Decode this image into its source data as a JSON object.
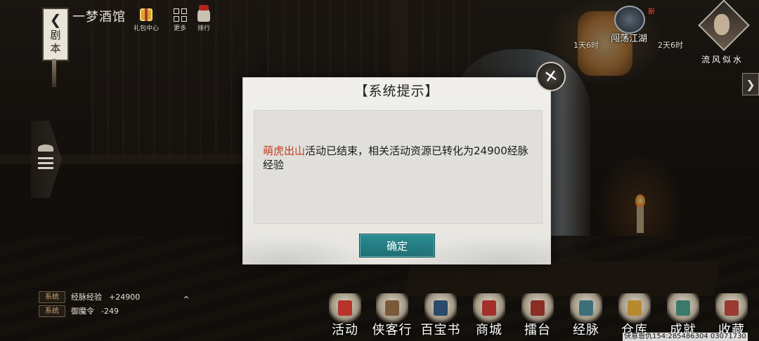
{
  "header": {
    "back_label": "剧本",
    "location": "一梦酒馆",
    "top_icons": [
      {
        "label": "礼包中心",
        "icon": "gift-icon"
      },
      {
        "label": "更多",
        "icon": "more-grid-icon"
      },
      {
        "label": "排行",
        "icon": "ranking-icon"
      }
    ]
  },
  "event": {
    "label": "闯荡江湖",
    "new_tag": "新",
    "timer_left": "1天6时",
    "timer_right": "2天6时"
  },
  "player": {
    "name": "流风似水"
  },
  "dialog": {
    "title": "【系统提示】",
    "highlight": "萌虎出山",
    "message": "活动已结束，相关活动资源已转化为24900经脉经验",
    "confirm": "确定"
  },
  "log": [
    {
      "tag": "系统",
      "text": "经脉经验",
      "value": "+24900"
    },
    {
      "tag": "系统",
      "text": "御魔令",
      "value": "-249"
    }
  ],
  "nav": [
    {
      "label": "活动",
      "icon": "drum-icon",
      "color": "#b8342a"
    },
    {
      "label": "侠客行",
      "icon": "scroll-icon",
      "color": "#7a5a3a"
    },
    {
      "label": "百宝书",
      "icon": "book-icon",
      "color": "#2c4a6b"
    },
    {
      "label": "商城",
      "icon": "shop-icon",
      "color": "#a3302a"
    },
    {
      "label": "擂台",
      "icon": "arena-icon",
      "color": "#8a2d25"
    },
    {
      "label": "经脉",
      "icon": "meridian-icon",
      "color": "#3d6f7a"
    },
    {
      "label": "仓库",
      "icon": "warehouse-icon",
      "color": "#b88a30"
    },
    {
      "label": "成就",
      "icon": "achievement-icon",
      "color": "#3a7a6a"
    },
    {
      "label": "收藏",
      "icon": "collection-icon",
      "color": "#9a3a30"
    }
  ],
  "watermark": "快意恩仇154:285486304 03071730",
  "colors": {
    "accent": "#1f7a80",
    "highlight": "#c43c22"
  }
}
